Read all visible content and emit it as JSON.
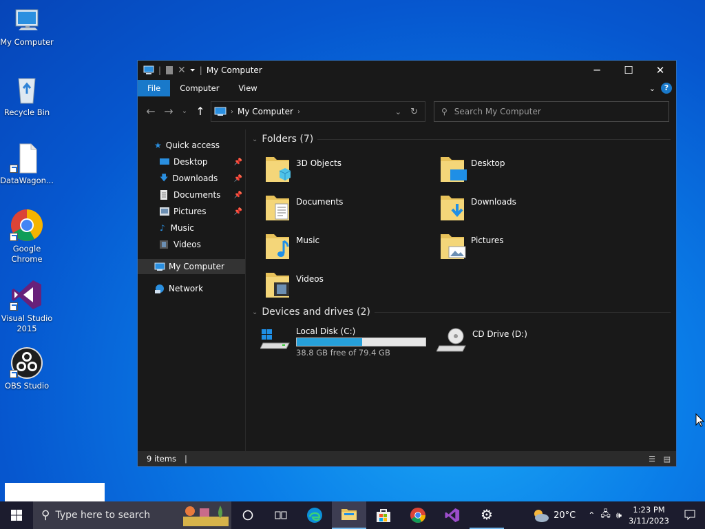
{
  "desktop": {
    "icons": [
      {
        "label": "My Computer",
        "icon": "monitor-icon"
      },
      {
        "label": "Recycle Bin",
        "icon": "recycle-bin-icon"
      },
      {
        "label": "DataWagon...",
        "icon": "file-icon"
      },
      {
        "label": "Google Chrome",
        "icon": "chrome-icon"
      },
      {
        "label": "Visual Studio 2015",
        "icon": "visual-studio-icon"
      },
      {
        "label": "OBS Studio",
        "icon": "obs-icon"
      }
    ]
  },
  "window": {
    "title": "My Computer",
    "ribbon": {
      "tabs": [
        "File",
        "Computer",
        "View"
      ],
      "help": "?"
    },
    "address": {
      "path": "My Computer"
    },
    "search": {
      "placeholder": "Search My Computer"
    },
    "sidebar": {
      "quick_access": "Quick access",
      "items": [
        "Desktop",
        "Downloads",
        "Documents",
        "Pictures",
        "Music",
        "Videos"
      ],
      "this_pc": "My Computer",
      "network": "Network"
    },
    "folders": {
      "header": "Folders (7)",
      "items": [
        "3D Objects",
        "Desktop",
        "Documents",
        "Downloads",
        "Music",
        "Pictures",
        "Videos"
      ]
    },
    "drives": {
      "header": "Devices and drives (2)",
      "items": [
        {
          "name": "Local Disk (C:)",
          "free": "38.8 GB free of 79.4 GB",
          "used_fraction": 0.51
        },
        {
          "name": "CD Drive (D:)"
        }
      ]
    },
    "status": {
      "items": "9 items"
    }
  },
  "taskbar": {
    "search_placeholder": "Type here to search",
    "weather": "20°C",
    "time": "1:23 PM",
    "date": "3/11/2023"
  },
  "colors": {
    "accent": "#1979ca",
    "drive_bar": "#26a0da",
    "titlebar": "#000000",
    "content_bg": "#191919"
  }
}
